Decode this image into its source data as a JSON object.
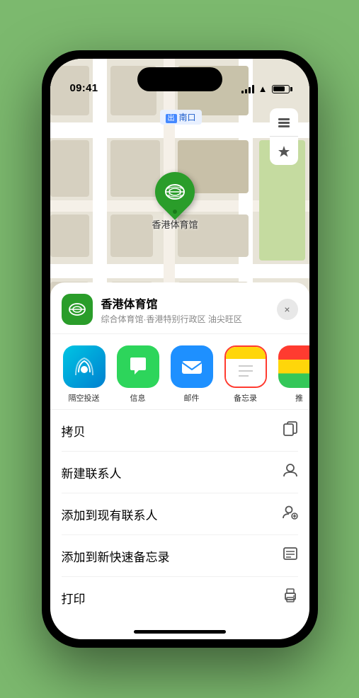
{
  "status_bar": {
    "time": "09:41",
    "location_arrow": "▲"
  },
  "map": {
    "label": "南口",
    "label_prefix": "出"
  },
  "venue": {
    "name": "香港体育馆",
    "subtitle": "综合体育馆·香港特别行政区 油尖旺区"
  },
  "share_items": [
    {
      "id": "airdrop",
      "label": "隔空投送",
      "icon": "📡"
    },
    {
      "id": "messages",
      "label": "信息",
      "icon": "💬"
    },
    {
      "id": "mail",
      "label": "邮件",
      "icon": "✉️"
    },
    {
      "id": "notes",
      "label": "备忘录",
      "icon": "📝"
    },
    {
      "id": "more",
      "label": "推",
      "icon": "•••"
    }
  ],
  "actions": [
    {
      "id": "copy",
      "label": "拷贝",
      "icon": "copy"
    },
    {
      "id": "new-contact",
      "label": "新建联系人",
      "icon": "person"
    },
    {
      "id": "add-contact",
      "label": "添加到现有联系人",
      "icon": "person-add"
    },
    {
      "id": "quick-note",
      "label": "添加到新快速备忘录",
      "icon": "note"
    },
    {
      "id": "print",
      "label": "打印",
      "icon": "print"
    }
  ],
  "close_label": "×",
  "home_indicator": true
}
